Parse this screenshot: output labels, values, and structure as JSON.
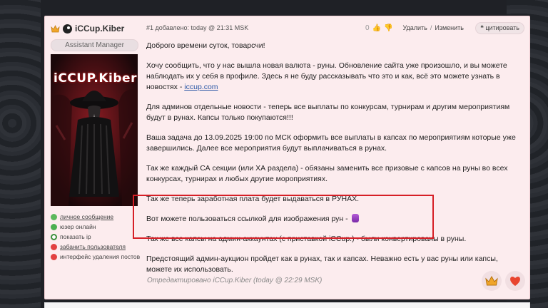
{
  "user": {
    "name": "iCCup.Kiber",
    "role": "Assistant Manager",
    "avatar_text": "iCCUP.Kiber",
    "links": [
      {
        "label": "личное сообщение",
        "color": "#5cb85c",
        "underline": true
      },
      {
        "label": "юзер онлайн",
        "color": "#4caf50",
        "underline": false
      },
      {
        "label": "показать ip",
        "color": "#3c8f3c",
        "underline": false
      },
      {
        "label": "забанить пользователя",
        "color": "#e24141",
        "underline": true
      },
      {
        "label": "интерфейс удаления постов",
        "color": "#e24141",
        "underline": false
      }
    ]
  },
  "post": {
    "meta": "#1 добавлено: today @ 21:31 MSK",
    "votes": "0",
    "delete_label": "Удалить",
    "edit_label": "Изменить",
    "quote_label": "цитировать",
    "paragraphs": [
      "Доброго времени суток, товарсчи!",
      "Хочу сообщить, что у нас вышла новая валюта - руны. Обновление сайта уже произошло, и вы можете наблюдать их у себя в профиле. Здесь я не буду рассказывать что это и как, всё это можете узнать в новостях - ",
      "Для админов отдельные новости - теперь все выплаты по конкурсам, турнирам и другим мероприятиям будут в рунах. Капсы только покупаются!!!",
      "Ваша задача до 13.09.2025 19:00 по МСК оформить все выплаты в капсах по мероприятиям которые уже завершились. Далее все мероприятия будут выплачиваться в рунах.",
      "Так же каждый СА секции (или ХА раздела) - обязаны заменить все призовые с капсов на руны во всех конкурсах, турнирах и любых другие мороприятиях.",
      "Так же теперь заработная плата будет выдаваться в РУНАХ.",
      "Вот можете пользоваться ссылкой для изображения рун - ",
      "Так же все капсы на админ-аккаунтах (с приставкой iCCup.) - были конвертированы в руны.",
      "Предстоящий админ-аукцион пройдет как в рунах, так и капсах. Неважно есть у вас руны или капсы, можете их использовать."
    ],
    "news_link": "iccup.com",
    "edited": "Отредактировано iCCup.Kiber (today @ 22:29 MSK)"
  },
  "colors": {
    "highlight": "#d61f26",
    "post_bg": "#fcecee"
  },
  "icons": {
    "reaction_1": "crown-icon",
    "reaction_2": "heart-icon"
  }
}
